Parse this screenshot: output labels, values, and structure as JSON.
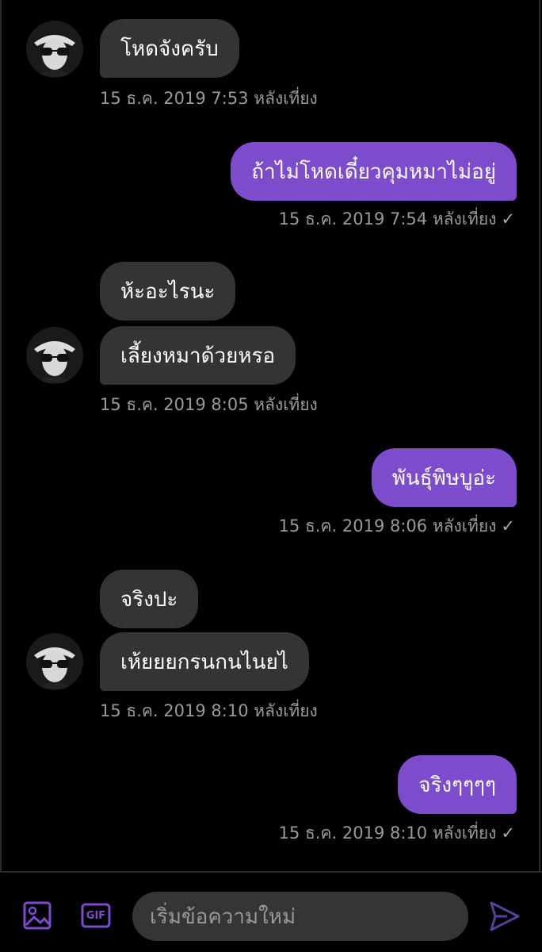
{
  "accent": "#7c4ccc",
  "messages": [
    {
      "text": "โหดจังครับ",
      "time": "15 ธ.ค. 2019 7:53 หลังเที่ยง"
    },
    {
      "text": "ถ้าไม่โหดเดี๋ยวคุมหมาไม่อยู่",
      "time": "15 ธ.ค. 2019 7:54 หลังเที่ยง"
    },
    {
      "text": "ห้ะอะไรนะ"
    },
    {
      "text": "เลี้ยงหมาด้วยหรอ",
      "time": "15 ธ.ค. 2019 8:05 หลังเที่ยง"
    },
    {
      "text": "พันธุ์พิษบูอ่ะ",
      "time": "15 ธ.ค. 2019 8:06 หลังเที่ยง"
    },
    {
      "text": "จริงปะ"
    },
    {
      "text": "เห้ยยยกรนกนไนยไ",
      "time": "15 ธ.ค. 2019 8:10 หลังเที่ยง"
    },
    {
      "text": "จริงๆๆๆๆ",
      "time": "15 ธ.ค. 2019 8:10 หลังเที่ยง"
    }
  ],
  "composer": {
    "placeholder": "เริ่มข้อความใหม่",
    "gif_label": "GIF",
    "image_icon": "image-icon",
    "send_icon": "send-icon"
  }
}
